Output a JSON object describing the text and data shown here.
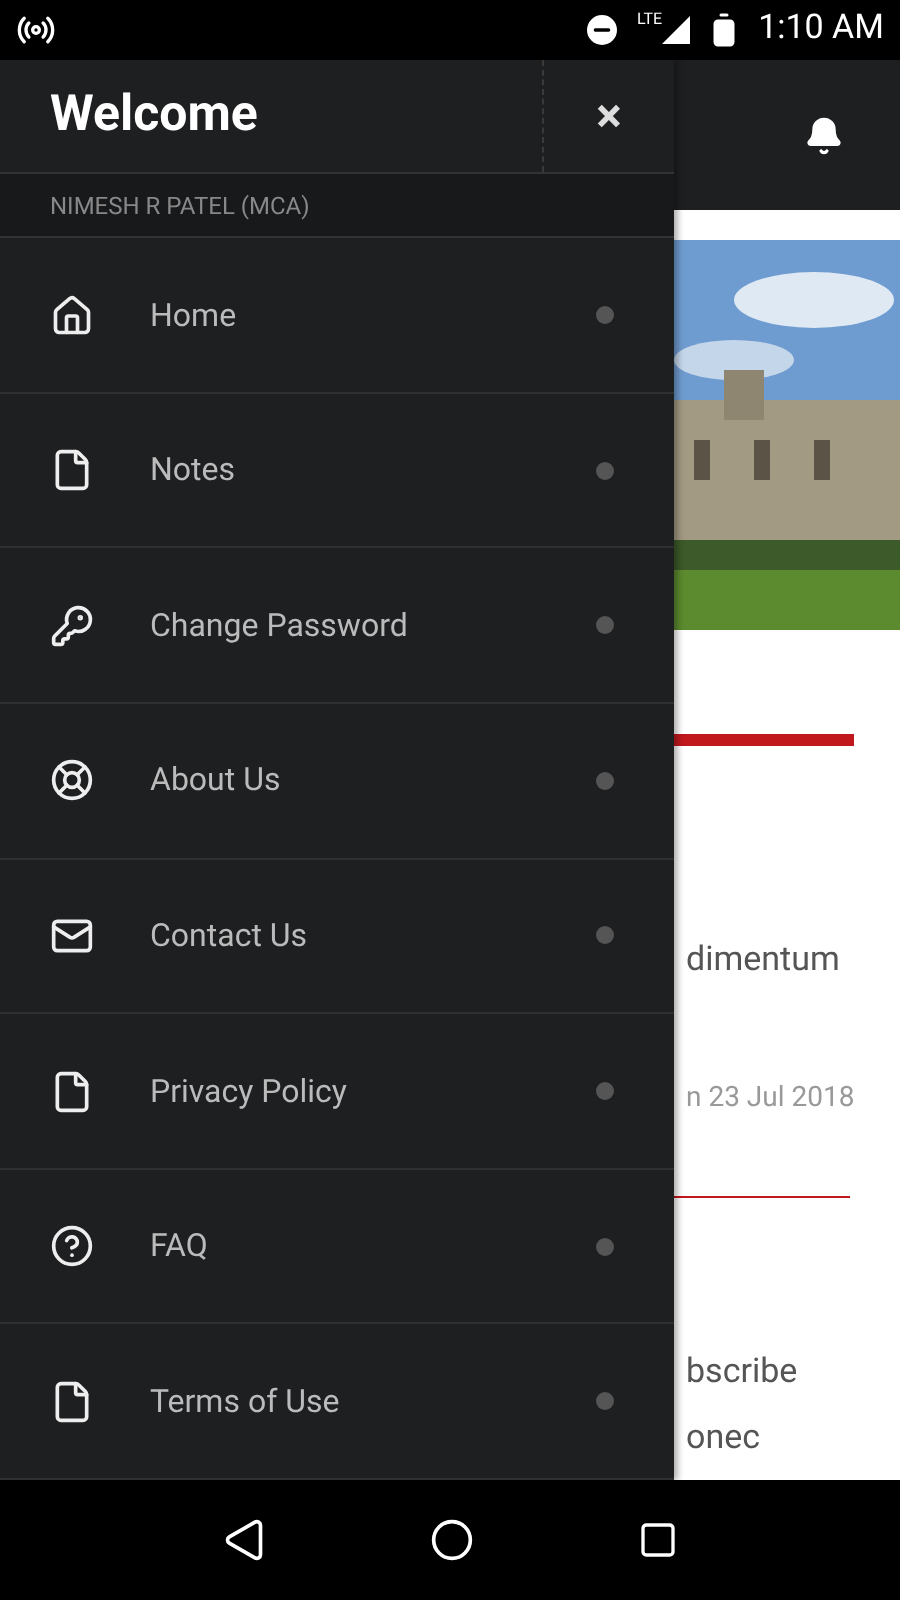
{
  "status_bar": {
    "time": "1:10 AM",
    "network": "LTE"
  },
  "drawer": {
    "title": "Welcome",
    "close": "×",
    "user": "NIMESH R PATEL (MCA)",
    "items": [
      {
        "label": "Home"
      },
      {
        "label": "Notes"
      },
      {
        "label": "Change Password"
      },
      {
        "label": "About Us"
      },
      {
        "label": "Contact Us"
      },
      {
        "label": "Privacy Policy"
      },
      {
        "label": "FAQ"
      },
      {
        "label": "Terms of Use"
      }
    ]
  },
  "content": {
    "text_1": "dimentum",
    "date": "n 23 Jul 2018",
    "text_2": "bscribe",
    "text_3": "onec"
  }
}
